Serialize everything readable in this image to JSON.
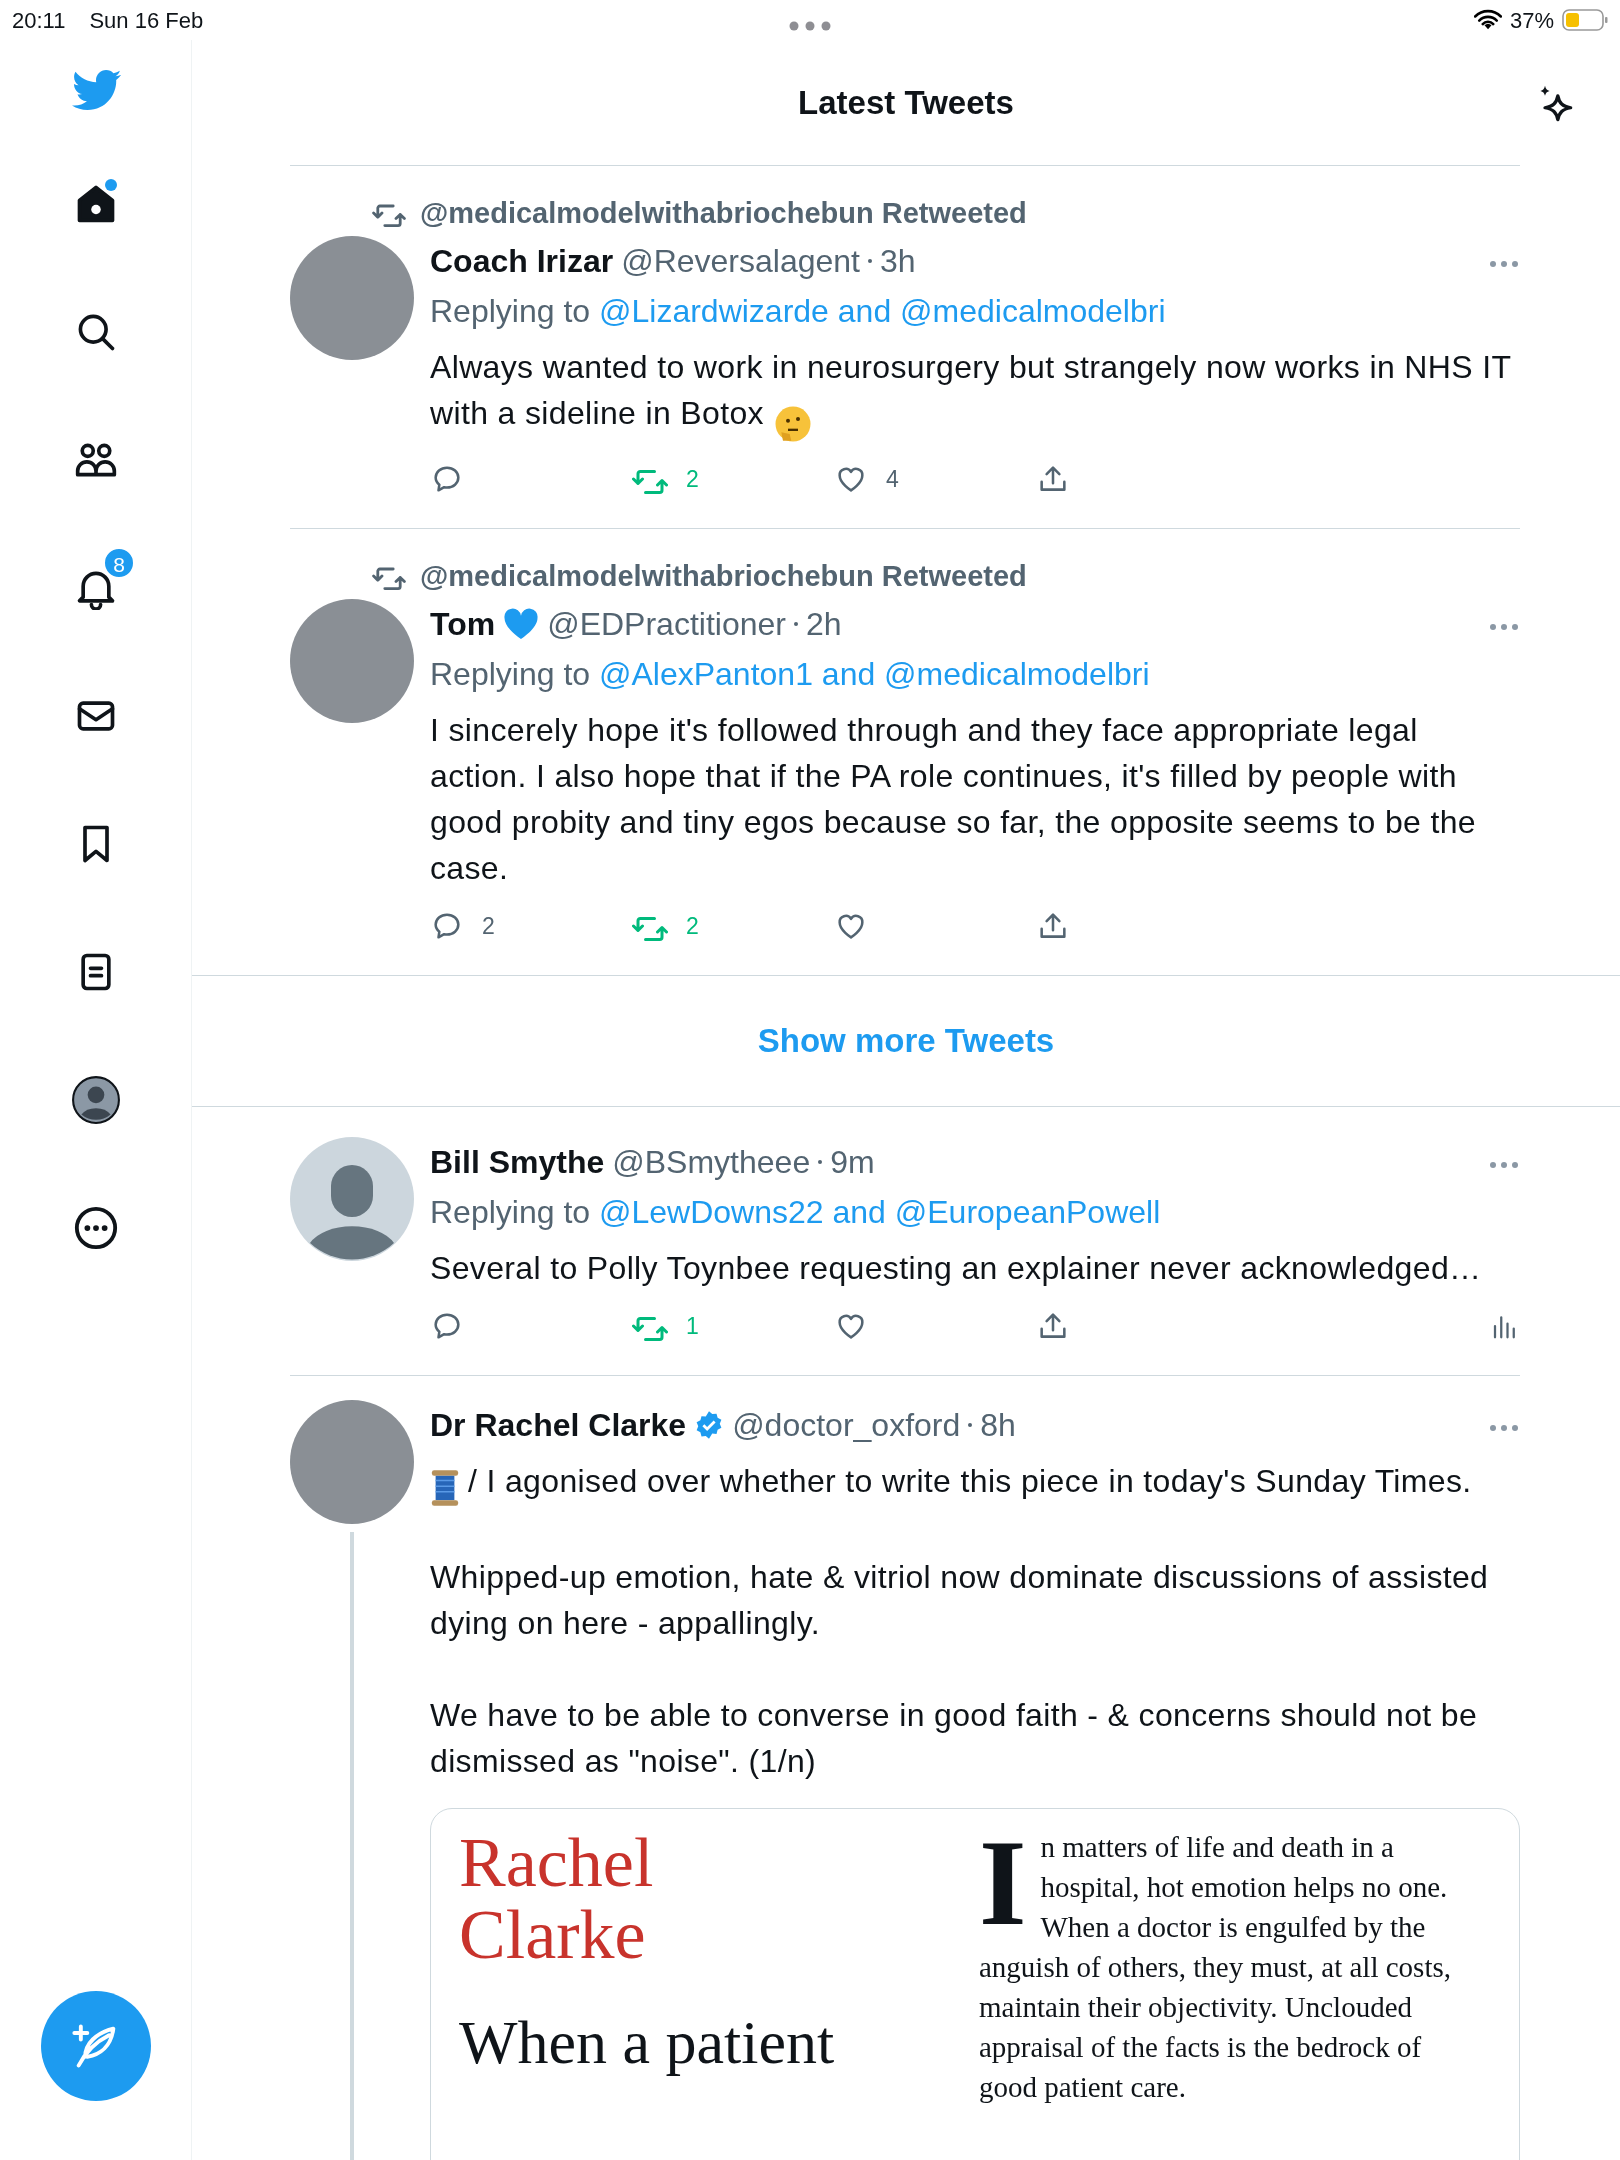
{
  "status_bar": {
    "time": "20:11",
    "date": "Sun 16 Feb",
    "battery": "37%"
  },
  "header": {
    "title": "Latest Tweets"
  },
  "sidebar": {
    "items": [
      {
        "kind": "home",
        "selected": true,
        "unread": true
      },
      {
        "kind": "search",
        "selected": false,
        "unread": false
      },
      {
        "kind": "communities",
        "selected": false,
        "unread": false
      },
      {
        "kind": "notifications",
        "selected": false,
        "unread": false,
        "badge": "8"
      },
      {
        "kind": "messages",
        "selected": false,
        "unread": false
      },
      {
        "kind": "bookmarks",
        "selected": false,
        "unread": false
      },
      {
        "kind": "lists",
        "selected": false,
        "unread": false
      },
      {
        "kind": "profile",
        "selected": false,
        "unread": false
      },
      {
        "kind": "more",
        "selected": false,
        "unread": false
      }
    ]
  },
  "timeline": [
    {
      "kind": "tweet",
      "retweeted_by": "@medicalmodelwithabriochebun Retweeted",
      "avatar": {
        "kind": "photo"
      },
      "name": "Coach Irizar",
      "verified": false,
      "thread": false,
      "handle": "@Reversalagent",
      "time": "3h",
      "replying_label": "Replying to",
      "replying_to": "@Lizardwizarde and @medicalmodelbri",
      "paragraphs": [
        "Always wanted to work in neurosurgery but strangely now works in NHS IT with a sideline in Botox"
      ],
      "emoji_after": {
        "kind": "thinking"
      },
      "actions": {
        "retweets": "2",
        "likes": "4",
        "retweeted": true,
        "analytics": false
      }
    },
    {
      "kind": "tweet",
      "retweeted_by": "@medicalmodelwithabriochebun Retweeted",
      "avatar": {
        "kind": "photo"
      },
      "name": "Tom",
      "name_emoji": {
        "kind": "blue-heart"
      },
      "verified": false,
      "thread": false,
      "handle": "@EDPractitioner",
      "time": "2h",
      "replying_label": "Replying to",
      "replying_to": "@AlexPanton1 and @medicalmodelbri",
      "paragraphs": [
        "I sincerely hope it's followed through and they face appropriate legal action. I also hope that if the PA role continues, it's filled by people with good probity and tiny egos because so far, the opposite seems to be the case."
      ],
      "actions": {
        "replies": "2",
        "retweets": "2",
        "retweeted": true,
        "analytics": false
      }
    },
    {
      "kind": "show_more",
      "label": "Show more Tweets"
    },
    {
      "kind": "tweet",
      "avatar": {
        "kind": "default"
      },
      "name": "Bill Smythe",
      "verified": false,
      "thread": false,
      "handle": "@BSmytheee",
      "time": "9m",
      "replying_label": "Replying to",
      "replying_to": "@LewDowns22 and @EuropeanPowell",
      "paragraphs": [
        "Several to Polly Toynbee requesting an explainer never acknowledged…"
      ],
      "actions": {
        "retweets": "1",
        "retweeted": true,
        "analytics": true
      }
    },
    {
      "kind": "tweet",
      "avatar": {
        "kind": "photo"
      },
      "name": "Dr Rachel Clarke",
      "verified": true,
      "thread": true,
      "handle": "@doctor_oxford",
      "time": "8h",
      "emoji_before": {
        "kind": "spool"
      },
      "paragraphs": [
        "/ I agonised over whether to write this piece in today's Sunday Times.",
        "Whipped-up emotion, hate & vitriol now dominate discussions of assisted dying on here - appallingly.",
        "We have to be able to converse in good faith - & concerns should not be dismissed as \"noise\". (1/n)"
      ],
      "article": {
        "byline": "Rachel Clarke",
        "headline": "When a patient",
        "drop_cap": "I",
        "body": "n matters of life and death in a hospital, hot emotion helps no one. When a doctor is engulfed by the anguish of others, they must, at all costs, maintain their objectivity. Unclouded appraisal of the facts is the bedrock of good patient care."
      }
    }
  ]
}
